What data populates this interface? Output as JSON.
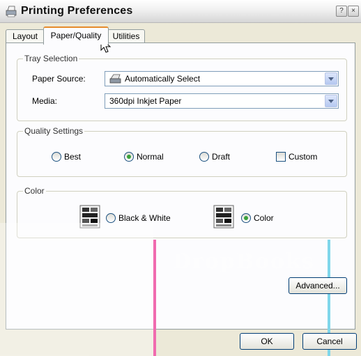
{
  "window": {
    "title": "Printing Preferences"
  },
  "titlebar_buttons": {
    "help": "?",
    "close": "×"
  },
  "tabs": [
    "Layout",
    "Paper/Quality",
    "Utilities"
  ],
  "tray_selection": {
    "title": "Tray Selection",
    "paper_source_label": "Paper Source:",
    "paper_source_value": "Automatically Select",
    "media_label": "Media:",
    "media_value": "360dpi Inkjet Paper"
  },
  "quality_settings": {
    "title": "Quality Settings",
    "options": [
      "Best",
      "Normal",
      "Draft"
    ],
    "selected": "Normal",
    "custom_label": "Custom",
    "custom_checked": false
  },
  "color": {
    "title": "Color",
    "bw_label": "Black & White",
    "color_label": "Color",
    "selected": "Color"
  },
  "buttons": {
    "advanced": "Advanced...",
    "ok": "OK",
    "cancel": "Cancel"
  },
  "watermark": "DropBooks",
  "colors": {
    "accent_tab": "#e68b2c",
    "radio_dot": "#3aa13a",
    "pink_stripe": "#f06baf",
    "cyan_stripe": "#7fd6ea"
  }
}
